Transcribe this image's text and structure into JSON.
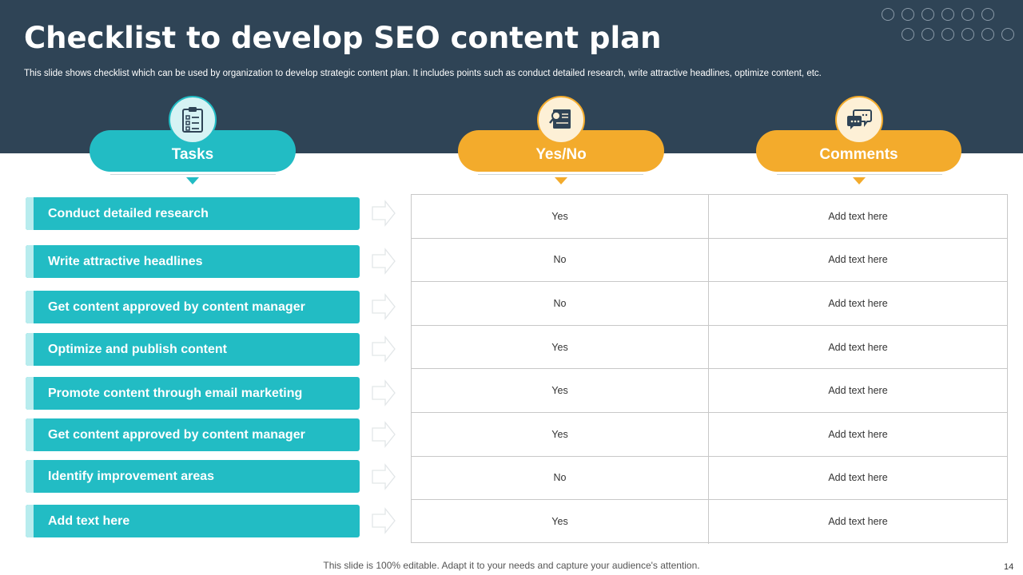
{
  "slide": {
    "title": "Checklist to develop SEO content plan",
    "subtitle": "This slide shows checklist which can be used by organization to develop strategic content plan. It includes points such as conduct detailed research, write attractive headlines, optimize content, etc.",
    "footer": "This slide is 100% editable. Adapt it to your needs and capture your audience's attention.",
    "page_number": "14"
  },
  "columns": {
    "tasks": {
      "label": "Tasks",
      "icon": "clipboard-checklist-icon",
      "color": "#22bcc4"
    },
    "yes_no": {
      "label": "Yes/No",
      "icon": "document-search-icon",
      "color": "#f3ab2c"
    },
    "comments": {
      "label": "Comments",
      "icon": "chat-bubbles-icon",
      "color": "#f3ab2c"
    }
  },
  "rows": [
    {
      "task": "Conduct detailed research",
      "yes_no": "Yes",
      "comment": "Add text here"
    },
    {
      "task": "Write attractive headlines",
      "yes_no": "No",
      "comment": "Add text here"
    },
    {
      "task": "Get content approved by content manager",
      "yes_no": "No",
      "comment": "Add text here"
    },
    {
      "task": "Optimize and publish content",
      "yes_no": "Yes",
      "comment": "Add text here"
    },
    {
      "task": "Promote content through email marketing",
      "yes_no": "Yes",
      "comment": "Add text here"
    },
    {
      "task": "Get content approved by content manager",
      "yes_no": "Yes",
      "comment": "Add text here"
    },
    {
      "task": "Identify improvement areas",
      "yes_no": "No",
      "comment": "Add text here"
    },
    {
      "task": "Add text here",
      "yes_no": "Yes",
      "comment": "Add text here"
    }
  ],
  "colors": {
    "header_bg": "#2f4456",
    "teal": "#22bcc4",
    "orange": "#f3ab2c"
  }
}
